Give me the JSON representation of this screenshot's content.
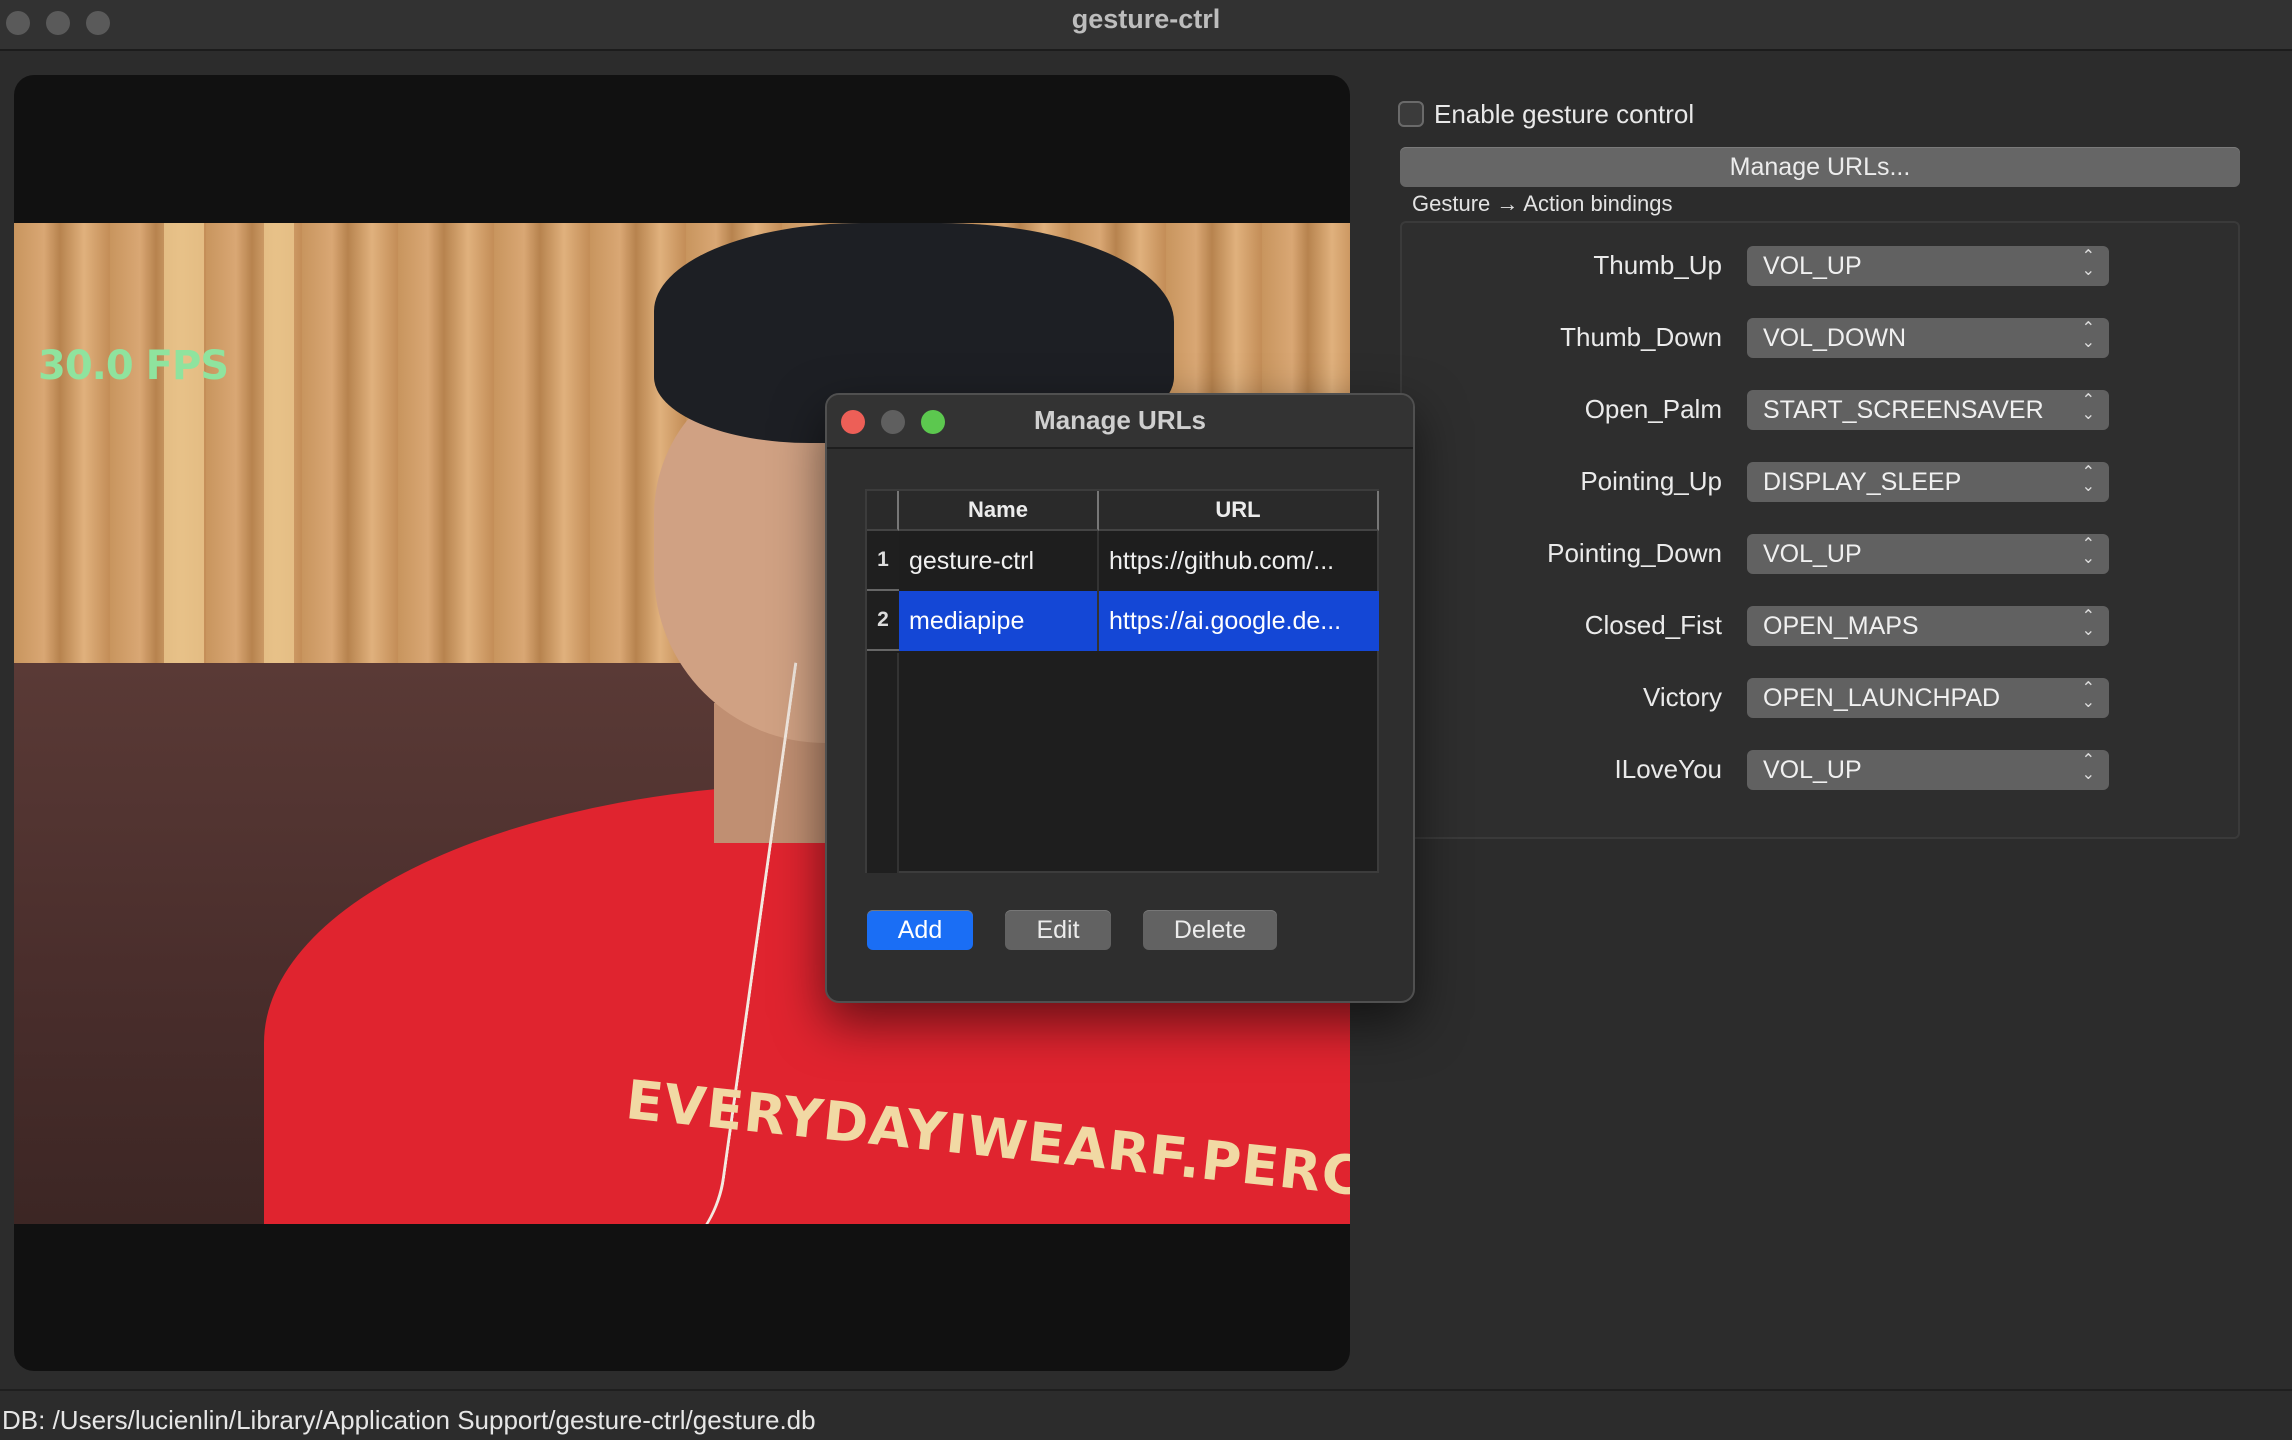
{
  "window": {
    "title": "gesture-ctrl"
  },
  "video": {
    "fps_overlay": "30.0 FPS",
    "shirt_text": "EVERYDAYIWEARF.PERCENT"
  },
  "controls": {
    "enable_label": "Enable gesture control",
    "enable_checked": false,
    "manage_button": "Manage URLs...",
    "group_title": "Gesture → Action bindings",
    "bindings": [
      {
        "gesture": "Thumb_Up",
        "action": "VOL_UP"
      },
      {
        "gesture": "Thumb_Down",
        "action": "VOL_DOWN"
      },
      {
        "gesture": "Open_Palm",
        "action": "START_SCREENSAVER"
      },
      {
        "gesture": "Pointing_Up",
        "action": "DISPLAY_SLEEP"
      },
      {
        "gesture": "Pointing_Down",
        "action": "VOL_UP"
      },
      {
        "gesture": "Closed_Fist",
        "action": "OPEN_MAPS"
      },
      {
        "gesture": "Victory",
        "action": "OPEN_LAUNCHPAD"
      },
      {
        "gesture": "ILoveYou",
        "action": "VOL_UP"
      }
    ]
  },
  "dialog": {
    "title": "Manage URLs",
    "columns": {
      "name": "Name",
      "url": "URL"
    },
    "rows": [
      {
        "index": "1",
        "name": "gesture-ctrl",
        "url": "https://github.com/...",
        "selected": false
      },
      {
        "index": "2",
        "name": "mediapipe",
        "url": "https://ai.google.de...",
        "selected": true
      }
    ],
    "buttons": {
      "add": "Add",
      "edit": "Edit",
      "delete": "Delete"
    }
  },
  "status": {
    "text": "DB: /Users/lucienlin/Library/Application Support/gesture-ctrl/gesture.db"
  },
  "colors": {
    "accent": "#1a6ef5",
    "selection": "#1447d6",
    "fps_green": "#8fe39e",
    "close_red": "#ed5f57",
    "zoom_green": "#5cc84f"
  }
}
